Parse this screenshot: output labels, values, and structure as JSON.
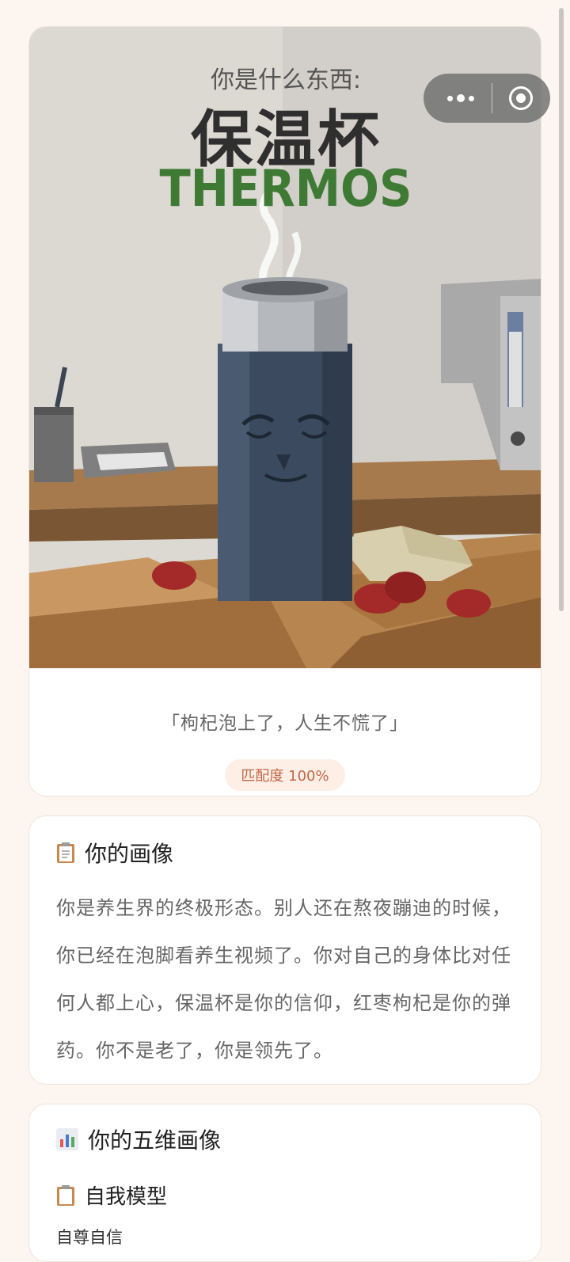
{
  "hero": {
    "header_text": "你是什么东西:",
    "title_cn": "保温杯",
    "title_en": "THERMOS",
    "quote": "「枸杞泡上了，人生不慌了」",
    "match_badge": "匹配度 100%"
  },
  "profile": {
    "icon": "clipboard-icon",
    "title": "你的画像",
    "text": "你是养生界的终极形态。别人还在熬夜蹦迪的时候，你已经在泡脚看养生视频了。你对自己的身体比对任何人都上心，保温杯是你的信仰，红枣枸杞是你的弹药。你不是老了，你是领先了。"
  },
  "five_dim": {
    "icon": "bar-chart-icon",
    "title": "你的五维画像",
    "sub_icon": "clipboard-icon",
    "sub_title": "自我模型",
    "first_item": "自尊自信"
  },
  "colors": {
    "background": "#fdf6f0",
    "accent": "#c0694a",
    "title_green": "#3f7a35",
    "thermos_body": "#3b4a5e"
  }
}
